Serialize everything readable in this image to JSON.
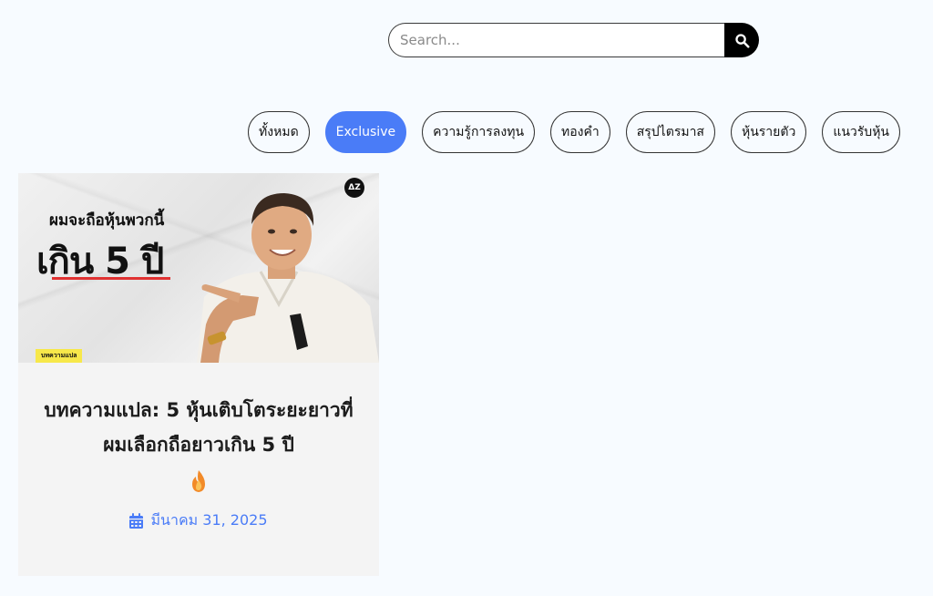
{
  "search": {
    "placeholder": "Search...",
    "button_icon": "search-icon"
  },
  "categories": [
    {
      "label": "ทั้งหมด",
      "active": false
    },
    {
      "label": "Exclusive",
      "active": true
    },
    {
      "label": "ความรู้การลงทุน",
      "active": false
    },
    {
      "label": "ทองคำ",
      "active": false
    },
    {
      "label": "สรุปไตรมาส",
      "active": false
    },
    {
      "label": "หุ้นรายตัว",
      "active": false
    },
    {
      "label": "แนวรับหุ้น",
      "active": false
    }
  ],
  "post": {
    "thumbnail": {
      "headline_small": "ผมจะถือหุ้นพวกนี้",
      "headline_big": "เกิน 5 ปี",
      "tag": "บทความแปล",
      "logo_text": "ΔΖ"
    },
    "title": "บทความแปล: 5 หุ้นเติบโตระยะยาวที่ผมเลือกถือยาวเกิน 5 ปี",
    "title_icon": "fire-icon",
    "date_icon": "calendar-icon",
    "date": "มีนาคม 31, 2025"
  },
  "colors": {
    "accent": "#4a7cf7",
    "background": "#f7fbff",
    "card_bg": "#f4f4f4",
    "underline_red": "#e03131",
    "tag_yellow": "#f7e84a"
  }
}
